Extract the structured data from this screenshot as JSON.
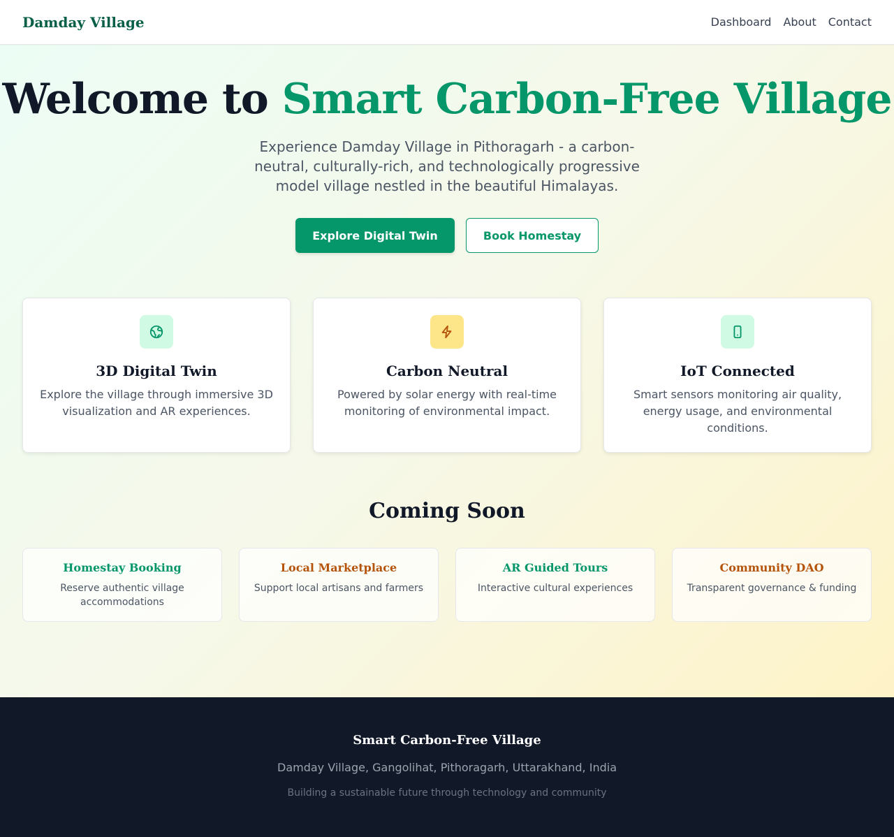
{
  "nav": {
    "brand": "Damday Village",
    "links": [
      "Dashboard",
      "About",
      "Contact"
    ]
  },
  "hero": {
    "title_prefix": "Welcome to",
    "title_accent": "Smart Carbon-Free Village",
    "lead": "Experience Damday Village in Pithoragarh - a carbon-neutral, culturally-rich, and technologically progressive model village nestled in the beautiful Himalayas.",
    "primary_button": "Explore Digital Twin",
    "secondary_button": "Book Homestay"
  },
  "features": [
    {
      "icon": "globe-icon",
      "title": "3D Digital Twin",
      "text": "Explore the village through immersive 3D visualization and AR experiences."
    },
    {
      "icon": "lightning-icon",
      "title": "Carbon Neutral",
      "text": "Powered by solar energy with real-time monitoring of environmental impact."
    },
    {
      "icon": "smartphone-icon",
      "title": "IoT Connected",
      "text": "Smart sensors monitoring air quality, energy usage, and environmental conditions."
    }
  ],
  "coming_soon": {
    "title": "Coming Soon",
    "items": [
      {
        "title": "Homestay Booking",
        "text": "Reserve authentic village accommodations",
        "color": "#059669"
      },
      {
        "title": "Local Marketplace",
        "text": "Support local artisans and farmers",
        "color": "#b45309"
      },
      {
        "title": "AR Guided Tours",
        "text": "Interactive cultural experiences",
        "color": "#059669"
      },
      {
        "title": "Community DAO",
        "text": "Transparent governance & funding",
        "color": "#b45309"
      }
    ]
  },
  "footer": {
    "title": "Smart Carbon-Free Village",
    "address": "Damday Village, Gangolihat, Pithoragarh, Uttarakhand, India",
    "tagline": "Building a sustainable future through technology and community"
  },
  "colors": {
    "accent": "#059669",
    "warm": "#b45309",
    "footer_bg": "#111827"
  }
}
